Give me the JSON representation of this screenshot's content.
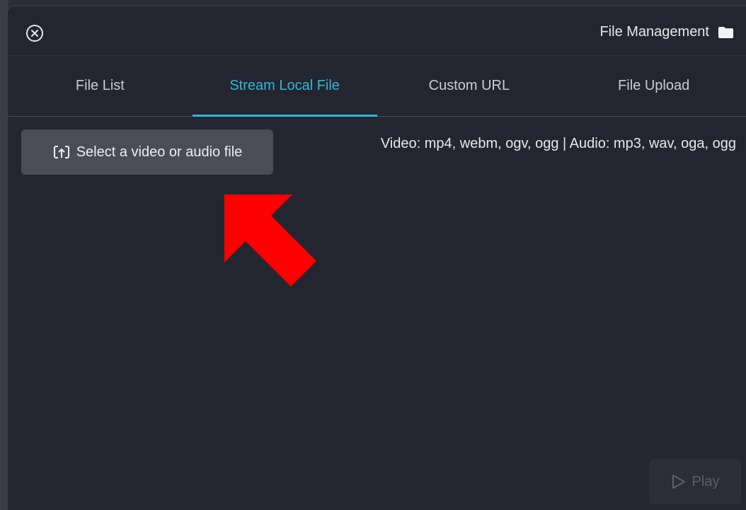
{
  "header": {
    "title": "File Management"
  },
  "tabs": [
    {
      "label": "File List",
      "active": false
    },
    {
      "label": "Stream Local File",
      "active": true
    },
    {
      "label": "Custom URL",
      "active": false
    },
    {
      "label": "File Upload",
      "active": false
    }
  ],
  "main": {
    "select_button_label": "Select a video or audio file",
    "supported_formats": "Video: mp4, webm, ogv, ogg | Audio: mp3, wav, oga, ogg"
  },
  "footer": {
    "play_label": "Play"
  },
  "colors": {
    "accent": "#2fb8d6",
    "annotation_arrow": "#ff0000",
    "background": "#232630"
  },
  "icons": [
    "close-circle-icon",
    "folder-icon",
    "upload-icon",
    "play-icon"
  ]
}
